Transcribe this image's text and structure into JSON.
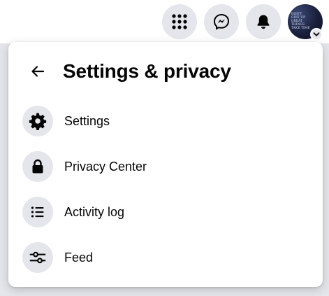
{
  "topbar": {
    "buttons": [
      {
        "name": "menu",
        "icon": "grid-menu-icon"
      },
      {
        "name": "messenger",
        "icon": "messenger-icon"
      },
      {
        "name": "notifications",
        "icon": "bell-icon"
      }
    ],
    "avatar": {
      "text_lines": [
        "DON'T",
        "GIVE UP",
        "GREAT",
        "THINGS",
        "TAKE TIME"
      ],
      "chevron_icon": "chevron-down-icon"
    }
  },
  "panel": {
    "back_icon": "arrow-left-icon",
    "title": "Settings & privacy",
    "items": [
      {
        "label": "Settings",
        "icon": "gear-icon"
      },
      {
        "label": "Privacy Center",
        "icon": "lock-icon"
      },
      {
        "label": "Activity log",
        "icon": "list-icon"
      },
      {
        "label": "Feed",
        "icon": "sliders-icon"
      }
    ]
  },
  "colors": {
    "page_background": "#e4e6eb",
    "icon_background": "#e4e6eb",
    "text": "#050505",
    "panel_background": "#ffffff"
  }
}
